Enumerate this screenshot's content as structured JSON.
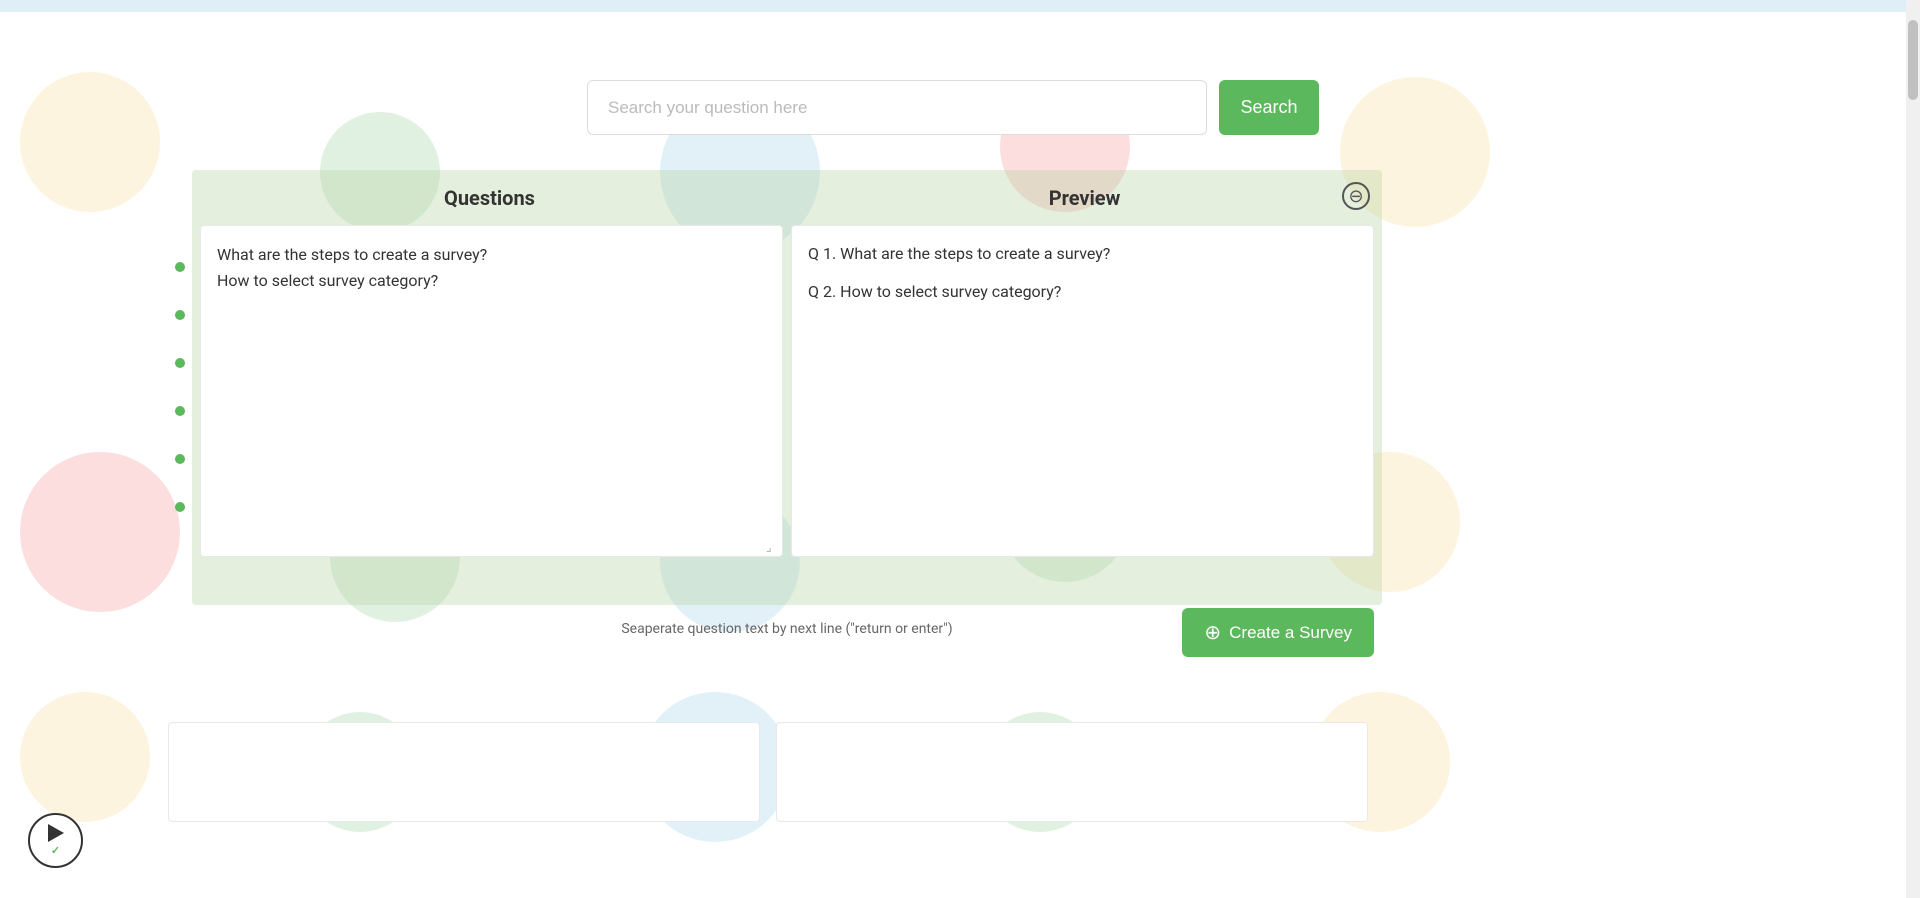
{
  "topbar": {},
  "search": {
    "placeholder": "Search your question here",
    "button_label": "Search"
  },
  "panel": {
    "questions_header": "Questions",
    "preview_header": "Preview",
    "close_icon": "⊖",
    "questions_content": "What are the steps to create a survey?\nHow to select survey category?",
    "preview_items": [
      "Q 1. What are the steps to create a survey?",
      "Q 2. How to select survey category?"
    ],
    "hint_text": "Seaperate question text by next line (\"return or enter\")",
    "create_button_label": "Create a Survey"
  },
  "bullets": [
    "•",
    "•",
    "•",
    "•",
    "•",
    "•"
  ],
  "colors": {
    "green": "#5cb85c",
    "panel_bg": "rgba(180,210,160,0.35)"
  }
}
